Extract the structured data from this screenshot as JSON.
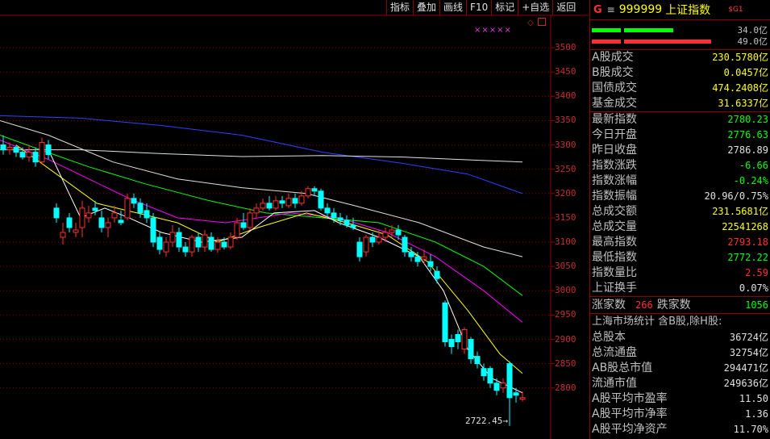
{
  "toolbar": {
    "buttons": [
      "指标",
      "叠加",
      "画线",
      "F10",
      "标记",
      "+自选",
      "返回"
    ]
  },
  "chart": {
    "marker_stars": "×××××",
    "low_label": "2722.45",
    "colors": {
      "up": "#ff3030",
      "down": "#00ffff",
      "ma5": "#ffffff",
      "ma10": "#ffff00",
      "ma20": "#ff00ff",
      "ma30": "#00ff00",
      "ma60": "#e0e0e0",
      "ma120": "#3040ff",
      "grid": "#8b0000"
    }
  },
  "chart_data": {
    "type": "candlestick",
    "y_ticks": [
      3500,
      3450,
      3400,
      3350,
      3300,
      3250,
      3200,
      3150,
      3100,
      3050,
      3000,
      2950,
      2900,
      2850,
      2800
    ],
    "ylim": [
      2695,
      3545
    ],
    "lowest_marker": 2722.45
  },
  "panel": {
    "g_icon": "G",
    "menu_icon": "≡",
    "code": "999999",
    "name": "上证指数",
    "sg": "$G1",
    "bar1_value": "34.0亿",
    "bar2_value": "49.0亿",
    "turnover": [
      {
        "label": "A股成交",
        "value": "230.5780亿",
        "color": "yellow"
      },
      {
        "label": "B股成交",
        "value": "0.0457亿",
        "color": "yellow"
      },
      {
        "label": "国债成交",
        "value": "474.2408亿",
        "color": "yellow"
      },
      {
        "label": "基金成交",
        "value": "31.6337亿",
        "color": "yellow"
      }
    ],
    "index_stats": [
      {
        "label": "最新指数",
        "value": "2780.23",
        "color": "green"
      },
      {
        "label": "今日开盘",
        "value": "2776.63",
        "color": "green"
      },
      {
        "label": "昨日收盘",
        "value": "2786.89",
        "color": "white"
      },
      {
        "label": "指数涨跌",
        "value": "-6.66",
        "color": "green"
      },
      {
        "label": "指数涨幅",
        "value": "-0.24%",
        "color": "green"
      },
      {
        "label": "指数振幅",
        "value": "20.96/0.75%",
        "color": "white"
      },
      {
        "label": "总成交额",
        "value": "231.5681亿",
        "color": "yellow"
      },
      {
        "label": "总成交量",
        "value": "22541268",
        "color": "yellow"
      },
      {
        "label": "最高指数",
        "value": "2793.18",
        "color": "red"
      },
      {
        "label": "最低指数",
        "value": "2772.22",
        "color": "green"
      },
      {
        "label": "指数量比",
        "value": "2.59",
        "color": "red"
      },
      {
        "label": "上证换手",
        "value": "0.07%",
        "color": "white"
      }
    ],
    "up_label": "涨家数",
    "up_value": "266",
    "down_label": "跌家数",
    "down_value": "1056",
    "market_head": "上海市场统计 含B股,除H股:",
    "market_stats": [
      {
        "label": "总股本",
        "value": "36724亿",
        "color": "white"
      },
      {
        "label": "总流通盘",
        "value": "32754亿",
        "color": "white"
      },
      {
        "label": "AB股总市值",
        "value": "294471亿",
        "color": "white"
      },
      {
        "label": "流通市值",
        "value": "249636亿",
        "color": "white"
      },
      {
        "label": "A股平均市盈率",
        "value": "11.50",
        "color": "white"
      },
      {
        "label": "A股平均市净率",
        "value": "1.36",
        "color": "white"
      },
      {
        "label": "A股平均净资产",
        "value": "11.70%",
        "color": "white"
      }
    ]
  }
}
